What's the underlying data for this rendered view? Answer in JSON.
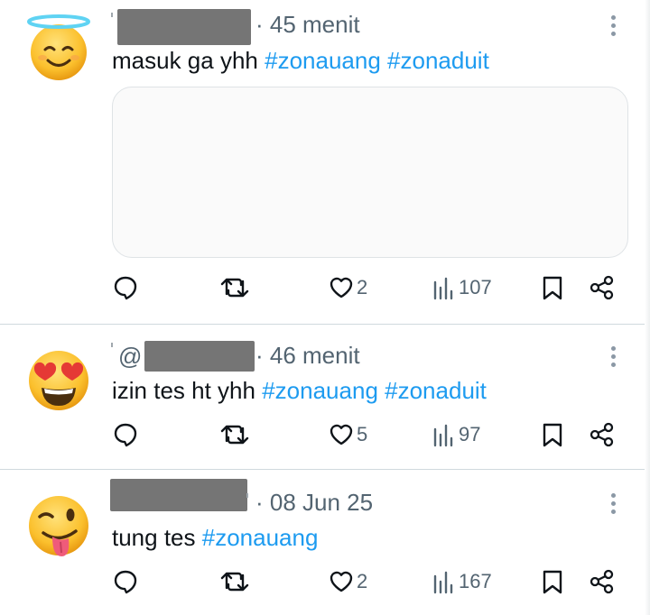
{
  "tweets": [
    {
      "avatar": "smiling-face-with-halo",
      "time": "· 45 menit",
      "text": "masuk ga yhh",
      "hashtags": [
        "#zonauang",
        "#zonaduit"
      ],
      "has_media": true,
      "likes": "2",
      "views": "107"
    },
    {
      "avatar": "smiling-face-with-heart-eyes",
      "handle_prefix": "@",
      "time": "· 46 menit",
      "text": "izin tes ht yhh",
      "hashtags": [
        "#zonauang",
        "#zonaduit"
      ],
      "has_media": false,
      "likes": "5",
      "views": "97"
    },
    {
      "avatar": "winking-face-with-tongue",
      "time": "· 08 Jun 25",
      "text": "tung tes",
      "hashtags": [
        "#zonauang"
      ],
      "has_media": false,
      "likes": "2",
      "views": "167"
    }
  ],
  "colors": {
    "hashtag": "#1d9bf0",
    "secondary_text": "#536471",
    "divider": "#cfd9de",
    "redaction": "#757575"
  }
}
